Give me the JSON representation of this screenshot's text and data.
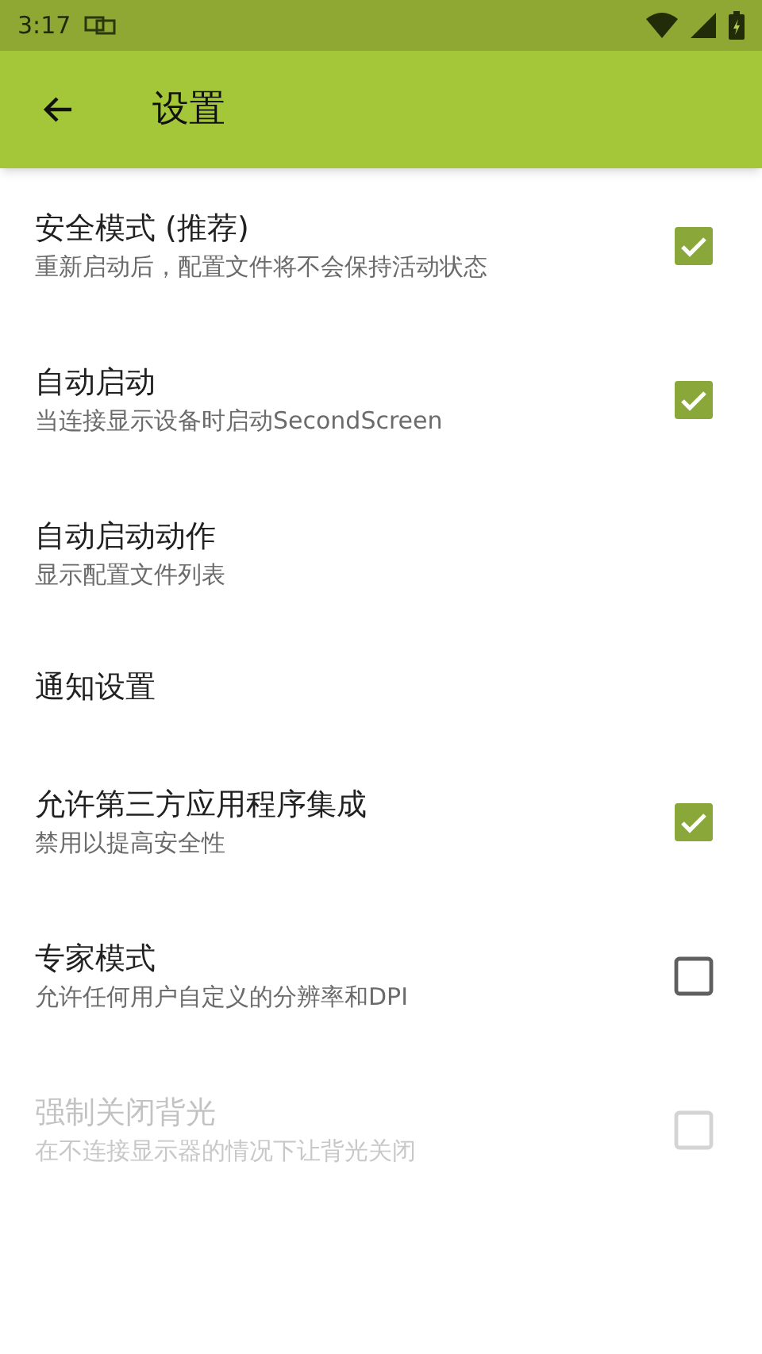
{
  "status_bar": {
    "time": "3:17"
  },
  "app_bar": {
    "title": "设置"
  },
  "settings": [
    {
      "kind": "checkbox",
      "title": "安全模式 (推荐)",
      "summary": "重新启动后，配置文件将不会保持活动状态",
      "checked": true,
      "disabled": false
    },
    {
      "kind": "checkbox",
      "title": "自动启动",
      "summary": "当连接显示设备时启动SecondScreen",
      "checked": true,
      "disabled": false
    },
    {
      "kind": "text",
      "title": "自动启动动作",
      "summary": "显示配置文件列表",
      "disabled": false
    },
    {
      "kind": "text",
      "title": "通知设置",
      "disabled": false
    },
    {
      "kind": "checkbox",
      "title": "允许第三方应用程序集成",
      "summary": "禁用以提高安全性",
      "checked": true,
      "disabled": false
    },
    {
      "kind": "checkbox",
      "title": "专家模式",
      "summary": "允许任何用户自定义的分辨率和DPI",
      "checked": false,
      "disabled": false
    },
    {
      "kind": "checkbox",
      "title": "强制关闭背光",
      "summary": "在不连接显示器的情况下让背光关闭",
      "checked": false,
      "disabled": true
    }
  ]
}
